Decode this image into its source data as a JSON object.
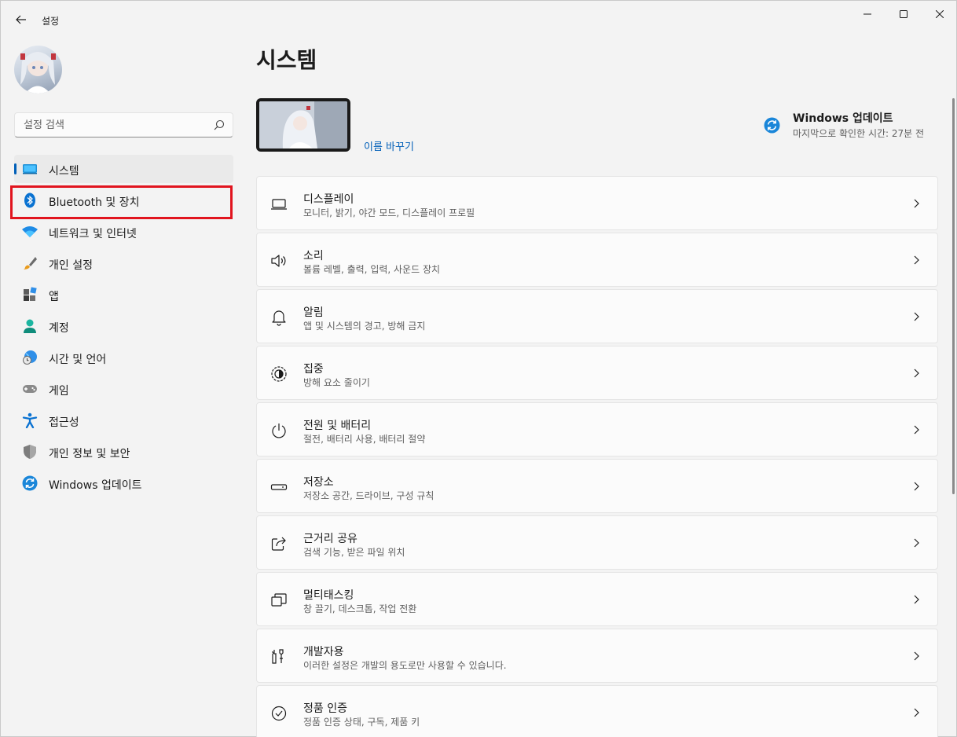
{
  "app": {
    "title": "설정"
  },
  "window_controls": {
    "minimize": "minimize-icon",
    "maximize": "maximize-icon",
    "close": "close-icon"
  },
  "sidebar": {
    "search": {
      "placeholder": "설정 검색",
      "value": ""
    },
    "items": [
      {
        "label": "시스템",
        "icon": "system-icon",
        "selected": true
      },
      {
        "label": "Bluetooth 및 장치",
        "icon": "bluetooth-icon",
        "highlighted": true
      },
      {
        "label": "네트워크 및 인터넷",
        "icon": "wifi-icon"
      },
      {
        "label": "개인 설정",
        "icon": "brush-icon"
      },
      {
        "label": "앱",
        "icon": "apps-icon"
      },
      {
        "label": "계정",
        "icon": "account-icon"
      },
      {
        "label": "시간 및 언어",
        "icon": "globe-clock-icon"
      },
      {
        "label": "게임",
        "icon": "gamepad-icon"
      },
      {
        "label": "접근성",
        "icon": "accessibility-icon"
      },
      {
        "label": "개인 정보 및 보안",
        "icon": "shield-icon"
      },
      {
        "label": "Windows 업데이트",
        "icon": "update-icon"
      }
    ]
  },
  "main": {
    "title": "시스템",
    "device": {
      "rename": "이름 바꾸기"
    },
    "update": {
      "title": "Windows 업데이트",
      "subtitle": "마지막으로 확인한 시간: 27분 전"
    },
    "cards": [
      {
        "title": "디스플레이",
        "desc": "모니터, 밝기, 야간 모드, 디스플레이 프로필",
        "icon": "display-icon"
      },
      {
        "title": "소리",
        "desc": "볼륨 레벨, 출력, 입력, 사운드 장치",
        "icon": "speaker-icon"
      },
      {
        "title": "알림",
        "desc": "앱 및 시스템의 경고, 방해 금지",
        "icon": "bell-icon"
      },
      {
        "title": "집중",
        "desc": "방해 요소 줄이기",
        "icon": "focus-icon"
      },
      {
        "title": "전원 및 배터리",
        "desc": "절전, 배터리 사용, 배터리 절약",
        "icon": "power-icon"
      },
      {
        "title": "저장소",
        "desc": "저장소 공간, 드라이브, 구성 규칙",
        "icon": "storage-icon"
      },
      {
        "title": "근거리 공유",
        "desc": "검색 기능, 받은 파일 위치",
        "icon": "share-icon"
      },
      {
        "title": "멀티태스킹",
        "desc": "창 끌기, 데스크톱, 작업 전환",
        "icon": "multitask-icon"
      },
      {
        "title": "개발자용",
        "desc": "이러한 설정은 개발의 용도로만 사용할 수 있습니다.",
        "icon": "developer-icon"
      },
      {
        "title": "정품 인증",
        "desc": "정품 인증 상태, 구독, 제품 키",
        "icon": "activation-icon"
      }
    ]
  },
  "colors": {
    "accent": "#005fb8",
    "highlight_box": "#e1141e"
  }
}
